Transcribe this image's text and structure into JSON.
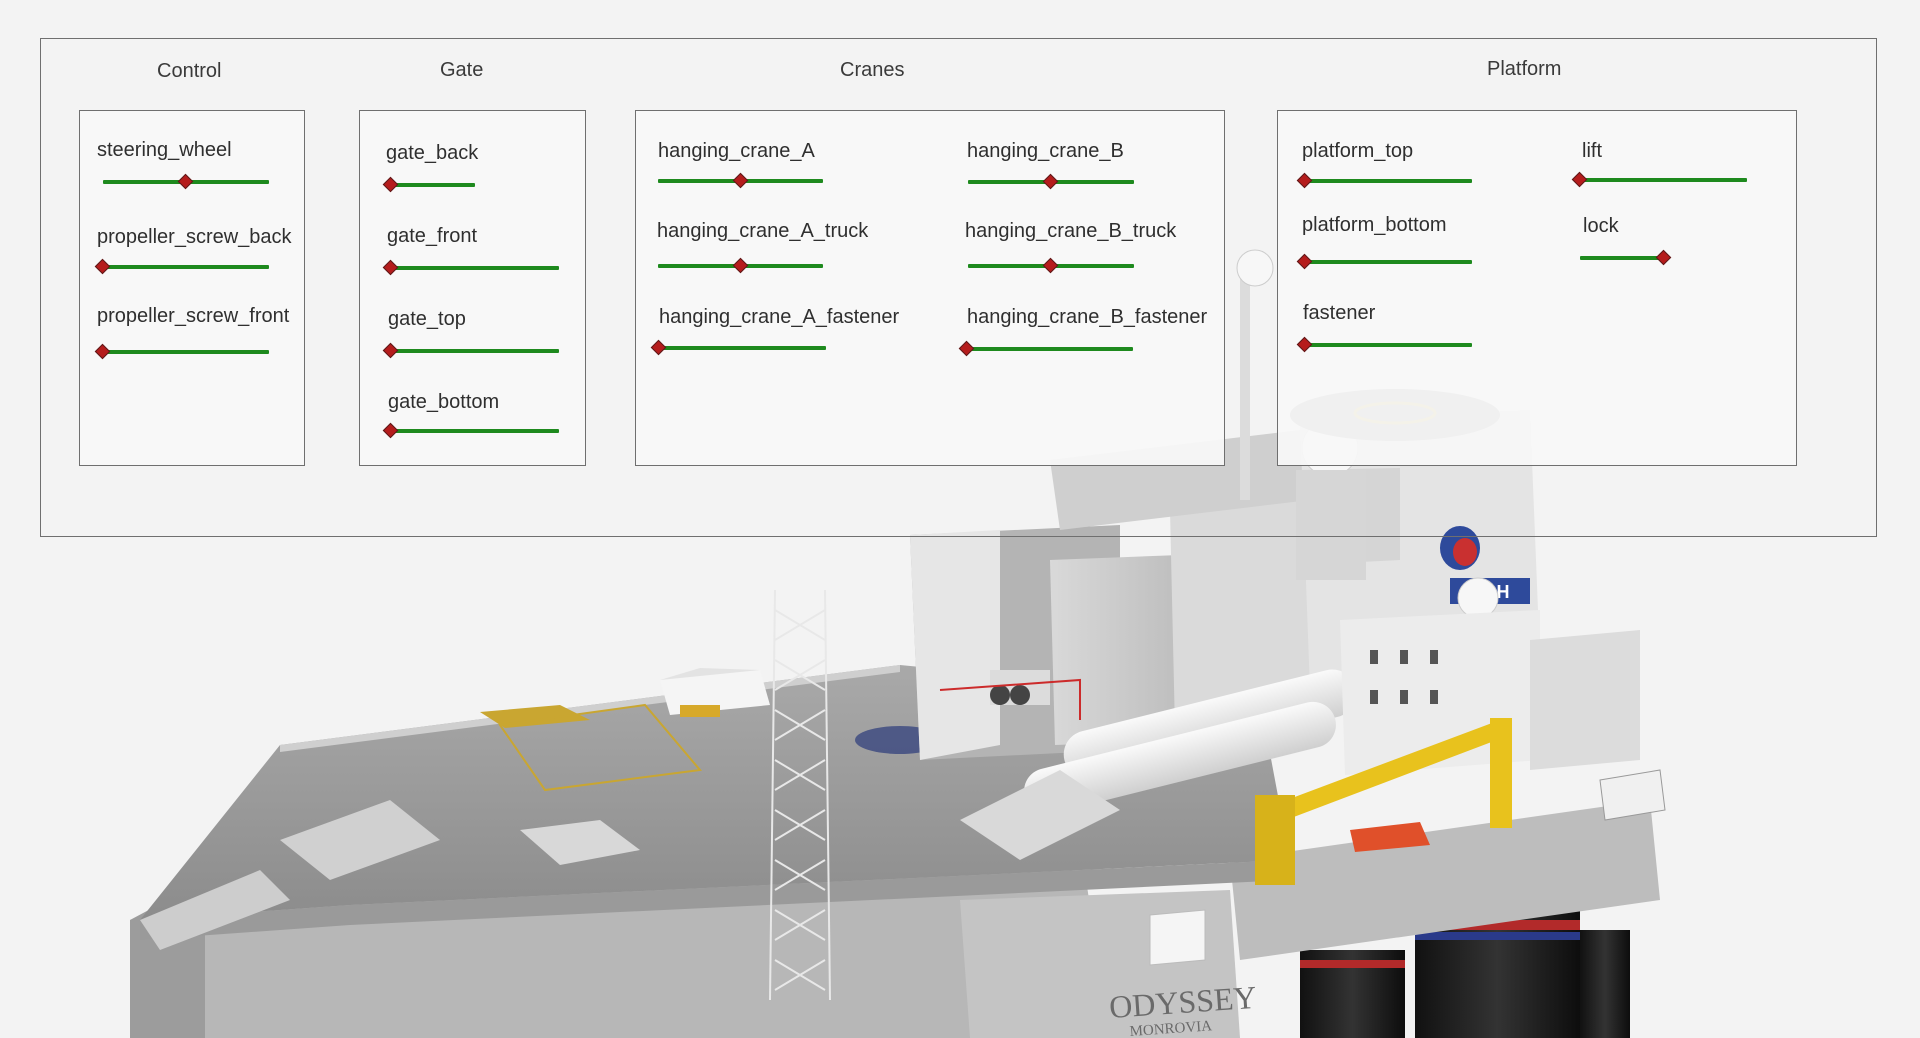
{
  "colors": {
    "slider_track": "#1e8a1e",
    "slider_knob": "#b51c1c",
    "panel_border": "#6f6f6f"
  },
  "groups": {
    "control": {
      "title": "Control",
      "sliders": [
        {
          "label": "steering_wheel",
          "value": 0.5
        },
        {
          "label": "propeller_screw_back",
          "value": 0.0
        },
        {
          "label": "propeller_screw_front",
          "value": 0.0
        }
      ]
    },
    "gate": {
      "title": "Gate",
      "sliders": [
        {
          "label": "gate_back",
          "value": 0.0
        },
        {
          "label": "gate_front",
          "value": 0.0
        },
        {
          "label": "gate_top",
          "value": 0.0
        },
        {
          "label": "gate_bottom",
          "value": 0.0
        }
      ]
    },
    "cranes": {
      "title": "Cranes",
      "sliders": [
        {
          "label": "hanging_crane_A",
          "value": 0.5
        },
        {
          "label": "hanging_crane_A_truck",
          "value": 0.5
        },
        {
          "label": "hanging_crane_A_fastener",
          "value": 0.0
        },
        {
          "label": "hanging_crane_B",
          "value": 0.5
        },
        {
          "label": "hanging_crane_B_truck",
          "value": 0.5
        },
        {
          "label": "hanging_crane_B_fastener",
          "value": 0.0
        }
      ]
    },
    "platform": {
      "title": "Platform",
      "sliders": [
        {
          "label": "platform_top",
          "value": 0.0
        },
        {
          "label": "platform_bottom",
          "value": 0.0
        },
        {
          "label": "fastener",
          "value": 0.0
        },
        {
          "label": "lift",
          "value": 0.0
        },
        {
          "label": "lock",
          "value": 1.0
        }
      ]
    }
  },
  "scene": {
    "hull_text": "ODYSSEY",
    "port_text": "MONROVIA",
    "sign_text": "NCH"
  }
}
